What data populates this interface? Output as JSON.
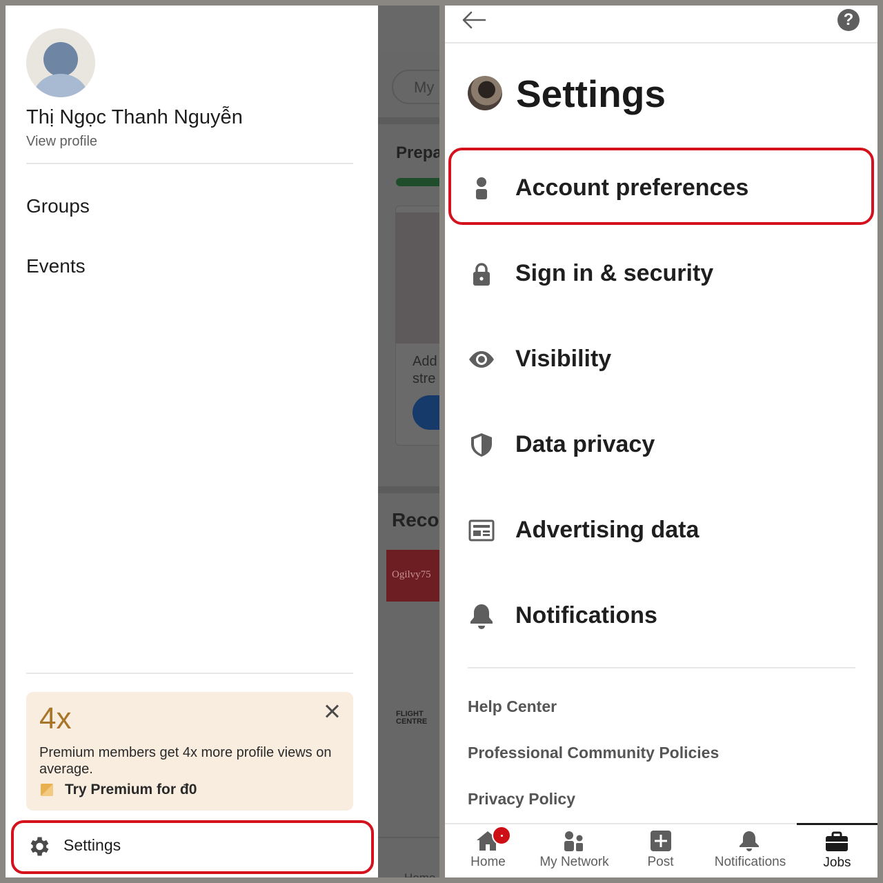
{
  "left_panel": {
    "user_name": "Thị Ngọc Thanh Nguyễn",
    "view_profile": "View profile",
    "menu": [
      "Groups",
      "Events"
    ],
    "promo": {
      "headline": "4x",
      "text": "Premium members get 4x more profile views on average.",
      "cta": "Try Premium for đ0"
    },
    "settings_label": "Settings"
  },
  "background_feed": {
    "pill_label": "My",
    "section_1": "Prepa",
    "card_text_1": "Add",
    "card_text_2": "stre",
    "section_2": "Reco",
    "logo_1": "Ogilvy75",
    "logo_2": "FLIGHT CENTRE",
    "tab_home": "Home"
  },
  "settings_page": {
    "title": "Settings",
    "items": [
      {
        "label": "Account preferences",
        "icon": "person-icon"
      },
      {
        "label": "Sign in & security",
        "icon": "lock-icon"
      },
      {
        "label": "Visibility",
        "icon": "eye-icon"
      },
      {
        "label": "Data privacy",
        "icon": "shield-icon"
      },
      {
        "label": "Advertising data",
        "icon": "ad-icon"
      },
      {
        "label": "Notifications",
        "icon": "bell-icon"
      }
    ],
    "links": [
      "Help Center",
      "Professional Community Policies",
      "Privacy Policy"
    ]
  },
  "tabbar": {
    "tabs": [
      {
        "label": "Home",
        "icon": "home-icon"
      },
      {
        "label": "My Network",
        "icon": "network-icon"
      },
      {
        "label": "Post",
        "icon": "plus-square-icon"
      },
      {
        "label": "Notifications",
        "icon": "bell-icon"
      },
      {
        "label": "Jobs",
        "icon": "briefcase-icon"
      }
    ],
    "active": "Jobs"
  },
  "colors": {
    "highlight": "#d4121e",
    "premium_gold": "#a87529",
    "promo_bg": "#f8eddf"
  }
}
